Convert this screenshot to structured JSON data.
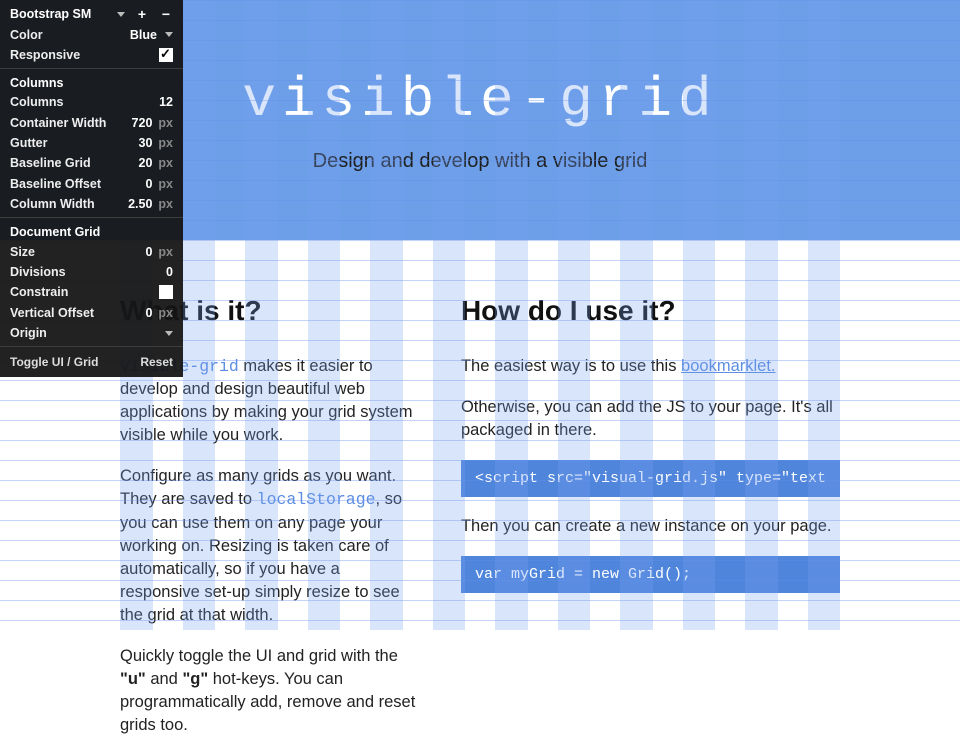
{
  "hero": {
    "title": "visible-grid",
    "subtitle": "Design and develop with a visible grid"
  },
  "left": {
    "heading": "What is it?",
    "p1a": "visible-grid",
    "p1b": " makes it easier to develop and design beautiful web applications by making your grid system visible while you work.",
    "p2a": "Configure as many grids as you want. They are saved to ",
    "p2b": "localStorage",
    "p2c": ", so you can use them on any page your working on. Resizing is taken care of automatically, so if you have a responsive set-up simply resize to see the grid at that width.",
    "p3a": "Quickly toggle the UI and grid with the ",
    "p3u": "\"u\"",
    "p3b": " and ",
    "p3g": "\"g\"",
    "p3c": " hot-keys. You can programmatically add, remove and reset grids too."
  },
  "right": {
    "heading": "How do I use it?",
    "p1a": "The easiest way is to use this ",
    "p1link": "bookmarklet.",
    "p2": "Otherwise, you can add the JS to your page. It's all packaged in there.",
    "code1": "<script src=\"visual-grid.js\" type=\"text",
    "p3": "Then you can create a new instance on your page.",
    "code2": "var myGrid = new Grid();"
  },
  "panel": {
    "preset": "Bootstrap SM",
    "color_label": "Color",
    "color_value": "Blue",
    "responsive_label": "Responsive",
    "section_columns": "Columns",
    "columns_label": "Columns",
    "columns_value": "12",
    "container_label": "Container Width",
    "container_value": "720",
    "gutter_label": "Gutter",
    "gutter_value": "30",
    "baseline_label": "Baseline Grid",
    "baseline_value": "20",
    "baseline_off_label": "Baseline Offset",
    "baseline_off_value": "0",
    "colwidth_label": "Column Width",
    "colwidth_value": "2.50",
    "section_doc": "Document Grid",
    "size_label": "Size",
    "size_value": "0",
    "divisions_label": "Divisions",
    "divisions_value": "0",
    "constrain_label": "Constrain",
    "voff_label": "Vertical Offset",
    "voff_value": "0",
    "origin_label": "Origin",
    "toggle_label": "Toggle UI / Grid",
    "reset_label": "Reset",
    "px": "px"
  }
}
